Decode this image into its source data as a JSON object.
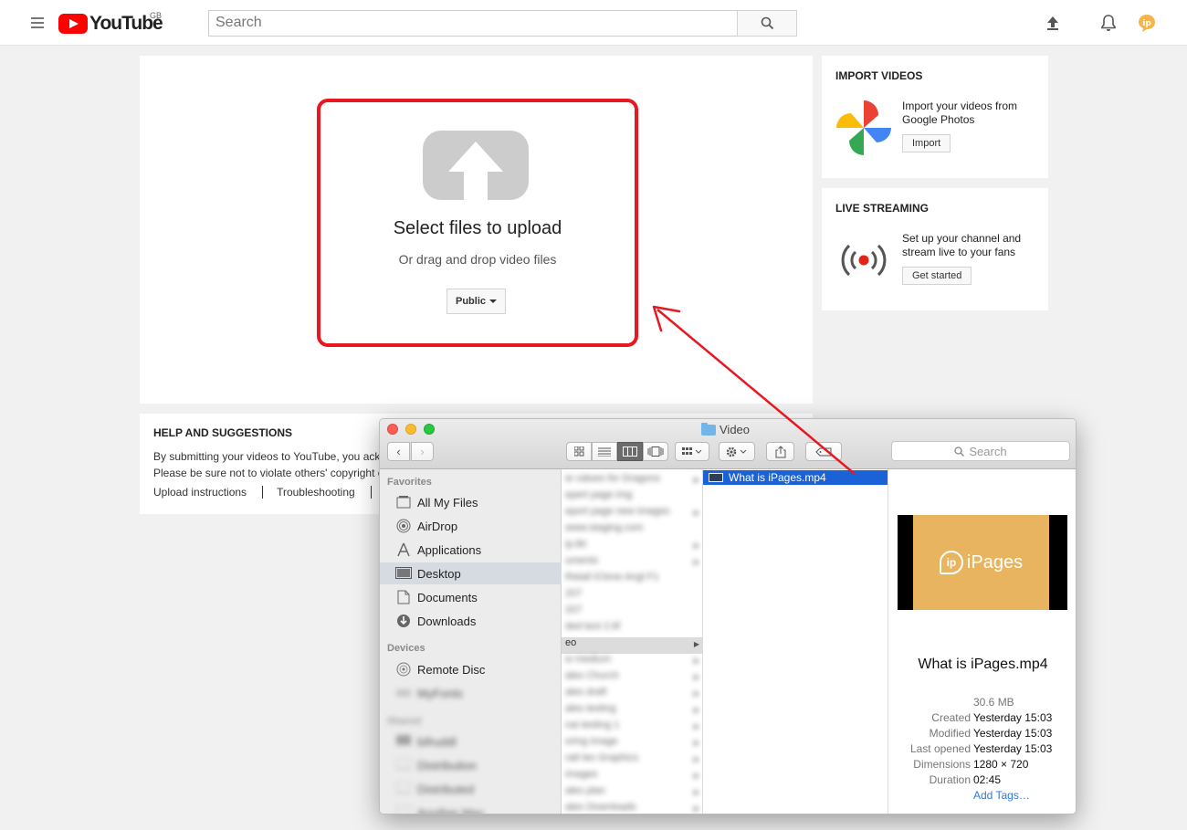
{
  "header": {
    "logo_text": "YouTube",
    "region": "GB",
    "search_placeholder": "Search"
  },
  "upload": {
    "title": "Select files to upload",
    "subtitle": "Or drag and drop video files",
    "privacy_label": "Public"
  },
  "import_card": {
    "title": "IMPORT VIDEOS",
    "text": "Import your videos from Google Photos",
    "button": "Import"
  },
  "live_card": {
    "title": "LIVE STREAMING",
    "text": "Set up your channel and stream live to your fans",
    "button": "Get started"
  },
  "help": {
    "title": "HELP AND SUGGESTIONS",
    "line1": "By submitting your videos to YouTube, you ackn",
    "line2": "Please be sure not to violate others' copyright o",
    "links": [
      "Upload instructions",
      "Troubleshooting"
    ]
  },
  "finder": {
    "title": "Video",
    "search_placeholder": "Search",
    "sidebar": {
      "favorites_heading": "Favorites",
      "favorites": [
        "All My Files",
        "AirDrop",
        "Applications",
        "Desktop",
        "Documents",
        "Downloads"
      ],
      "devices_heading": "Devices",
      "devices": [
        "Remote Disc",
        "MyFonts"
      ],
      "shared_heading": "Shared",
      "shared": [
        "bifruddl",
        "Distribution",
        "Distributed",
        "Another Mac"
      ]
    },
    "column1": [
      "ie values for Dragons",
      "epert page img",
      "eport page new images",
      "www.staging.com",
      "ip.tkt",
      "uments",
      "Retail iClone Angl F1",
      "207",
      "207",
      "ded text 2.tif",
      "eo",
      "w medium",
      "ales Church",
      "ales draft",
      "ales testing",
      "nai testing 1",
      "oring image",
      "ratt les Graphics",
      "images",
      "ales plan",
      "ales Downloads"
    ],
    "column1_selected": "eo",
    "selected_file": "What is iPages.mp4",
    "preview": {
      "brand": "iPages",
      "name": "What is iPages.mp4",
      "size": "30.6 MB",
      "meta": [
        {
          "key": "Created",
          "value": "Yesterday 15:03"
        },
        {
          "key": "Modified",
          "value": "Yesterday 15:03"
        },
        {
          "key": "Last opened",
          "value": "Yesterday 15:03"
        },
        {
          "key": "Dimensions",
          "value": "1280 × 720"
        },
        {
          "key": "Duration",
          "value": "02:45"
        }
      ],
      "add_tags": "Add Tags…"
    }
  },
  "colors": {
    "youtube_red": "#ff0000",
    "highlight_red": "#e9171f",
    "finder_selection": "#1a62d6"
  }
}
